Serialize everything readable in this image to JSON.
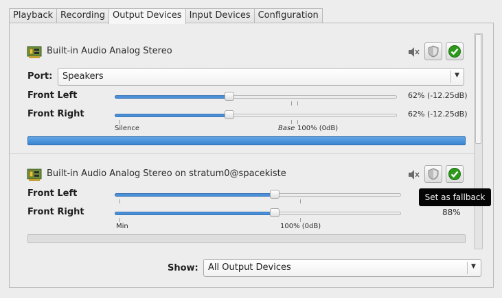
{
  "tabs": [
    {
      "label": "Playback",
      "active": false
    },
    {
      "label": "Recording",
      "active": false
    },
    {
      "label": "Output Devices",
      "active": true
    },
    {
      "label": "Input Devices",
      "active": false
    },
    {
      "label": "Configuration",
      "active": false
    }
  ],
  "devices": [
    {
      "title": "Built-in Audio Analog Stereo",
      "port_label": "Port:",
      "port_value": "Speakers",
      "fallback_active": true,
      "channels": [
        {
          "label": "Front Left",
          "percent": 62,
          "level_text": "62% (-12.25dB)"
        },
        {
          "label": "Front Right",
          "percent": 62,
          "level_text": "62% (-12.25dB)"
        }
      ],
      "scale": {
        "left": "Silence",
        "base_word": "Base",
        "right": "100% (0dB)"
      },
      "peak_level": 1.0
    },
    {
      "title": "Built-in Audio Analog Stereo on stratum0@spacekiste",
      "fallback_active": true,
      "channels": [
        {
          "label": "Front Left",
          "percent": 88
        },
        {
          "label": "Front Right",
          "percent": 88,
          "level_text": "88%"
        }
      ],
      "scale": {
        "left": "Min",
        "right": "100% (0dB)"
      },
      "peak_level": 0.0
    }
  ],
  "show": {
    "label": "Show:",
    "value": "All Output Devices"
  },
  "tooltip": "Set as fallback",
  "colors": {
    "accent": "#4a90d9",
    "fallback_green": "#2d9a1c",
    "tooltip_bg": "#050505"
  },
  "icons": {
    "device": "audio-card-icon",
    "mute": "speaker-muted-icon",
    "lock": "shield-lock-icon",
    "fallback": "checkmark-icon",
    "dropdown": "chevron-down-icon"
  }
}
